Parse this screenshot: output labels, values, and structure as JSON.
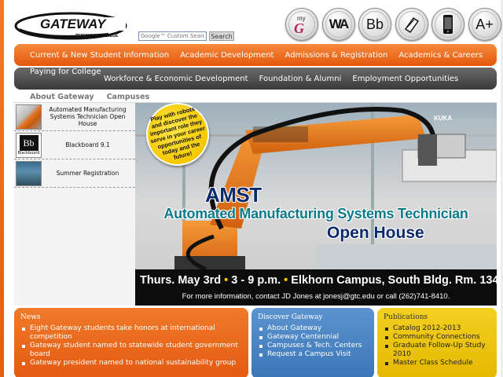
{
  "logo": {
    "name": "GATEWAY",
    "tagline": "TECHNICAL COLLEGE"
  },
  "search": {
    "placeholder": "Google™ Custom Search",
    "button_label": "Search"
  },
  "quick_icons": [
    {
      "label": "myG",
      "icon": "my-gateway-icon"
    },
    {
      "label": "WA",
      "icon": "webadvisor-icon"
    },
    {
      "label": "Bb",
      "icon": "blackboard-icon"
    },
    {
      "label": "",
      "icon": "book-icon"
    },
    {
      "label": "",
      "icon": "mobile-phone-icon"
    },
    {
      "label": "A+",
      "icon": "text-size-icon"
    }
  ],
  "nav_primary": [
    "Current & New Student Information",
    "Academic Development",
    "Admissions & Registration",
    "Academics & Careers"
  ],
  "nav_secondary": [
    "Paying for College",
    "Workforce & Economic Development",
    "Foundation & Alumni",
    "Employment Opportunities"
  ],
  "sub_nav": [
    "About Gateway",
    "Campuses"
  ],
  "sidebar": [
    {
      "label": "Automated Manufacturing Systems Technician Open House",
      "thumb": "robot-thumbnail"
    },
    {
      "label": "Blackboard 9.1",
      "thumb_text": "Bb",
      "thumb_caption": "Blackboard"
    },
    {
      "label": "Summer Registration",
      "thumb": "summer-thumbnail"
    }
  ],
  "banner": {
    "bubble": "Play with robots and discover the important role they serve in your career opportunities of today and the future!",
    "robot_text": "KUKA",
    "title": "AMST",
    "subtitle": "Automated Manufacturing Systems Technician",
    "title2": "Open House",
    "event_date": "Thurs. May 3rd",
    "event_time": "3 - 9 p.m.",
    "event_location": "Elkhorn Campus, South Bldg. Rm. 134",
    "contact": "For more information, contact JD Jones at jonesj@gtc.edu or call (262)741-8410."
  },
  "news": {
    "title": "News",
    "items": [
      "Eight Gateway students take honors at international competition",
      "Gateway student named to statewide student government board",
      "Gateway president named to national sustainability group"
    ]
  },
  "discover": {
    "title": "Discover Gateway",
    "items": [
      "About Gateway",
      "Gateway Centennial",
      "Campuses & Tech. Centers",
      "Request a Campus Visit"
    ]
  },
  "publications": {
    "title": "Publications",
    "items": [
      "Catalog 2012-2013",
      "Community Connections",
      "Graduate Follow-Up Study 2010",
      "Master Class Schedule"
    ]
  },
  "colors": {
    "orange": "#e8641a",
    "dark_nav": "#4a4a4a",
    "blue": "#4a85c4",
    "yellow": "#efc814",
    "navy": "#0b2a6e",
    "teal": "#0d7a8a"
  }
}
